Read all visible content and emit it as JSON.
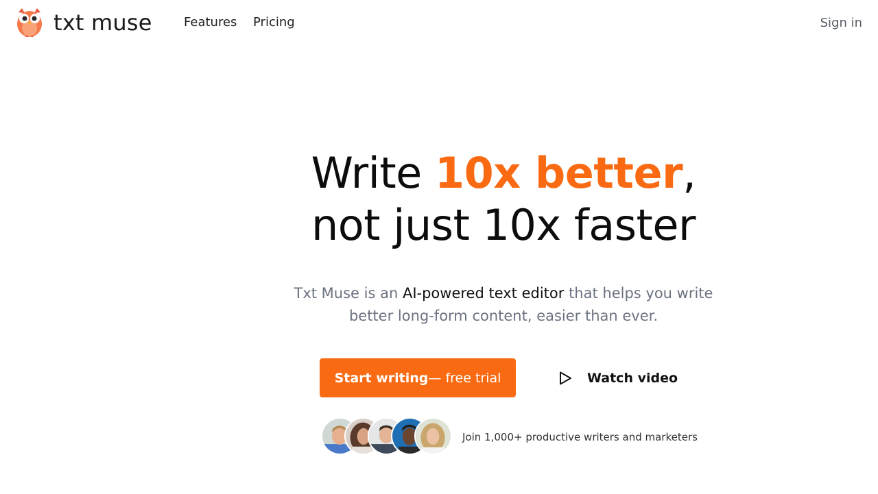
{
  "brand": {
    "name": "txt muse",
    "logo_icon": "owl-logo-icon",
    "accent_color": "#f96a12"
  },
  "nav": {
    "features": "Features",
    "pricing": "Pricing",
    "sign_in": "Sign in"
  },
  "hero": {
    "title_line1_prefix": "Write ",
    "title_line1_accent": "10x better",
    "title_line1_suffix": ",",
    "title_line2": "not just 10x faster",
    "subtitle_prefix": "Txt Muse is an ",
    "subtitle_strong": "AI-powered text editor",
    "subtitle_suffix": " that helps you write",
    "subtitle_line2": "better long-form content, easier than ever."
  },
  "cta": {
    "primary_bold": "Start writing",
    "primary_rest": " — free trial",
    "secondary": "Watch video",
    "secondary_icon": "play-icon"
  },
  "social_proof": {
    "avatars": [
      "avatar-man-blonde",
      "avatar-woman-curly",
      "avatar-man-suit",
      "avatar-woman-blue",
      "avatar-woman-blonde"
    ],
    "text": "Join 1,000+ productive writers and marketers"
  }
}
